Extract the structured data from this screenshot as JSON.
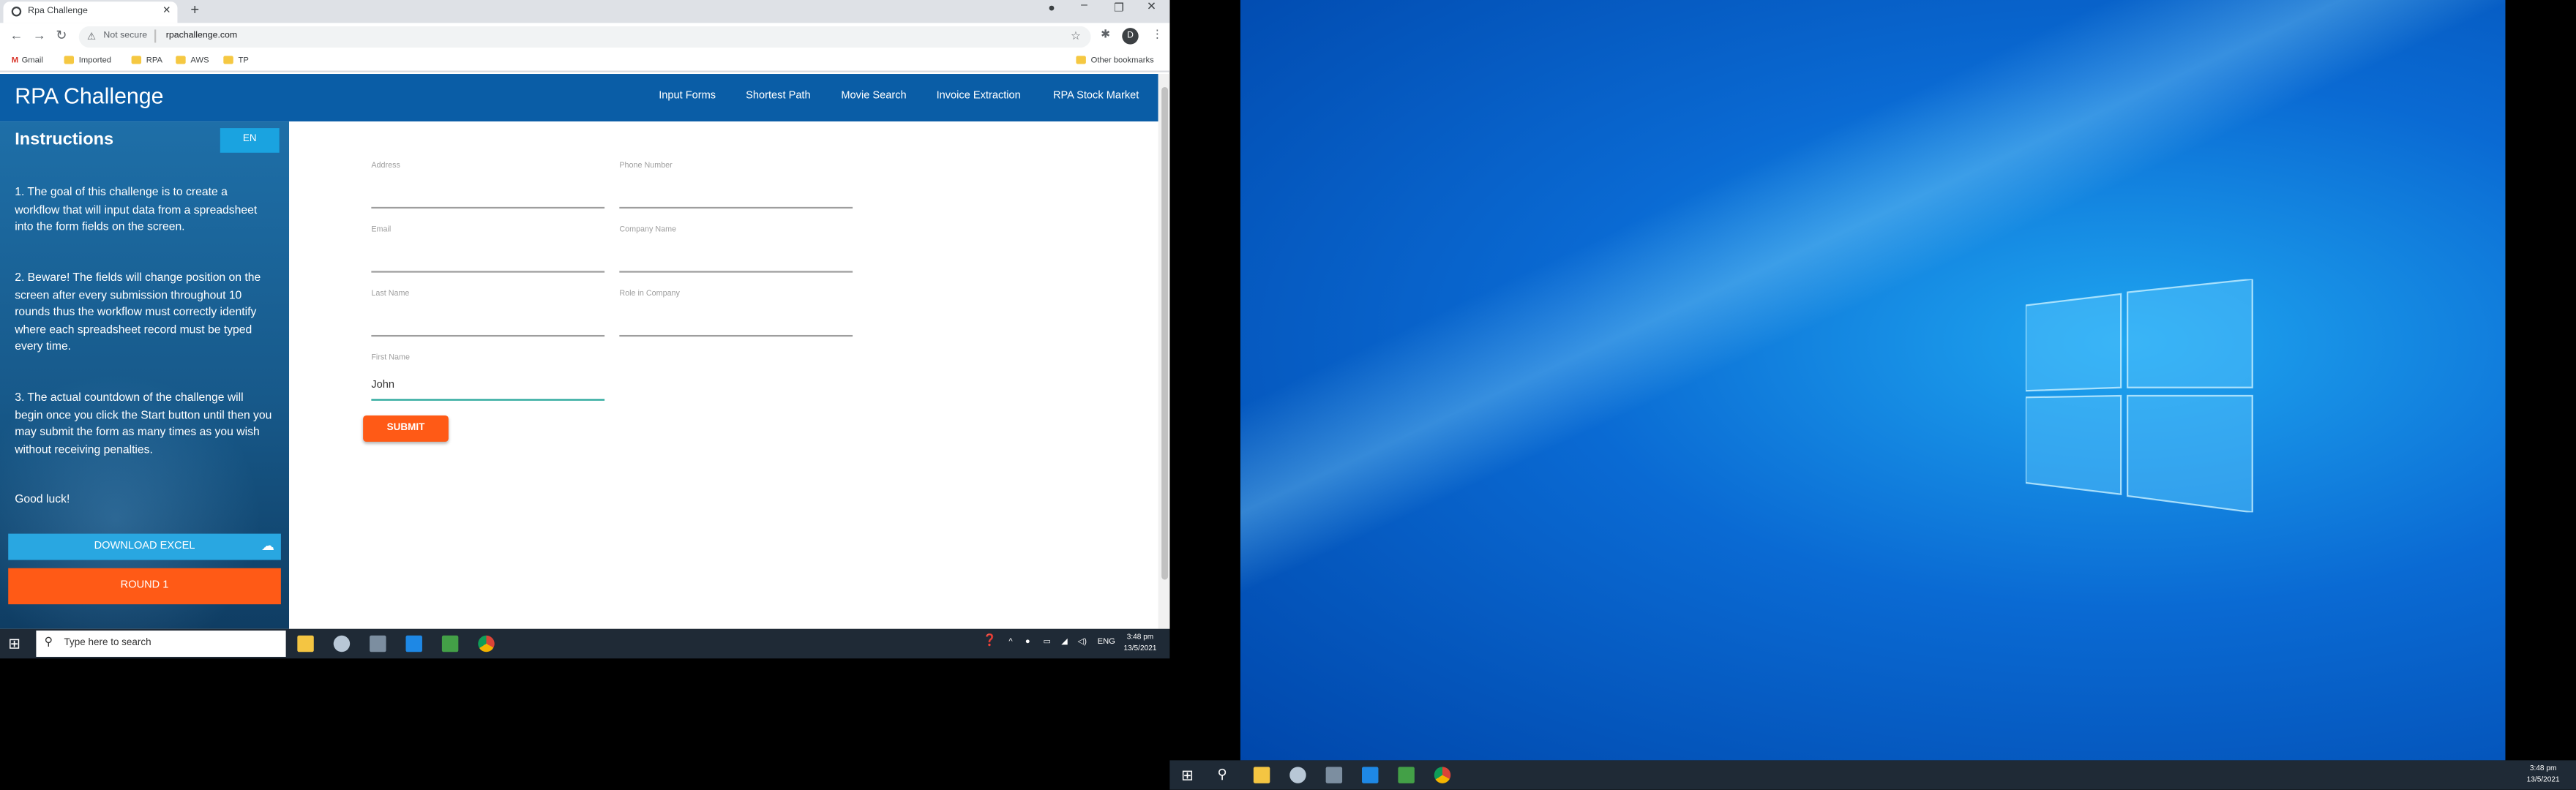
{
  "browser": {
    "tab_title": "Rpa Challenge",
    "security_label": "Not secure",
    "url": "rpachallenge.com",
    "profile_initial": "D",
    "bookmarks": [
      "Gmail",
      "Imported",
      "RPA",
      "AWS",
      "TP"
    ],
    "other_bookmarks": "Other bookmarks"
  },
  "site": {
    "brand": "RPA Challenge",
    "nav": [
      "Input Forms",
      "Shortest Path",
      "Movie Search",
      "Invoice Extraction",
      "RPA Stock Market"
    ]
  },
  "sidebar": {
    "title": "Instructions",
    "lang_button": "EN",
    "instructions": [
      "1. The goal of this challenge is to create a workflow that will input data from a spreadsheet into the form fields on the screen.",
      "2. Beware! The fields will change position on the screen after every submission throughout 10 rounds thus the workflow must correctly identify where each spreadsheet record must be typed every time.",
      "3. The actual countdown of the challenge will begin once you click the Start button until then you may submit the form as many times as you wish without receiving penalties.",
      "Good luck!"
    ],
    "download_button": "DOWNLOAD EXCEL",
    "round_button": "ROUND 1"
  },
  "form": {
    "fields": [
      {
        "label": "Address",
        "value": ""
      },
      {
        "label": "Phone Number",
        "value": ""
      },
      {
        "label": "Email",
        "value": ""
      },
      {
        "label": "Company Name",
        "value": ""
      },
      {
        "label": "Last Name",
        "value": ""
      },
      {
        "label": "Role in Company",
        "value": ""
      },
      {
        "label": "First Name",
        "value": "John"
      }
    ],
    "submit_label": "SUBMIT"
  },
  "taskbar_left": {
    "search_placeholder": "Type here to search",
    "lang": "ENG",
    "time": "3:48 pm",
    "date": "13/5/2021"
  },
  "taskbar_right": {
    "time": "3:48 pm",
    "date": "13/5/2021"
  },
  "colors": {
    "site_header": "#0a5da6",
    "accent_orange": "#ff5a16",
    "accent_blue": "#29a7e1",
    "desktop_blue": "#0a6ad3",
    "taskbar": "#1f2a36"
  }
}
